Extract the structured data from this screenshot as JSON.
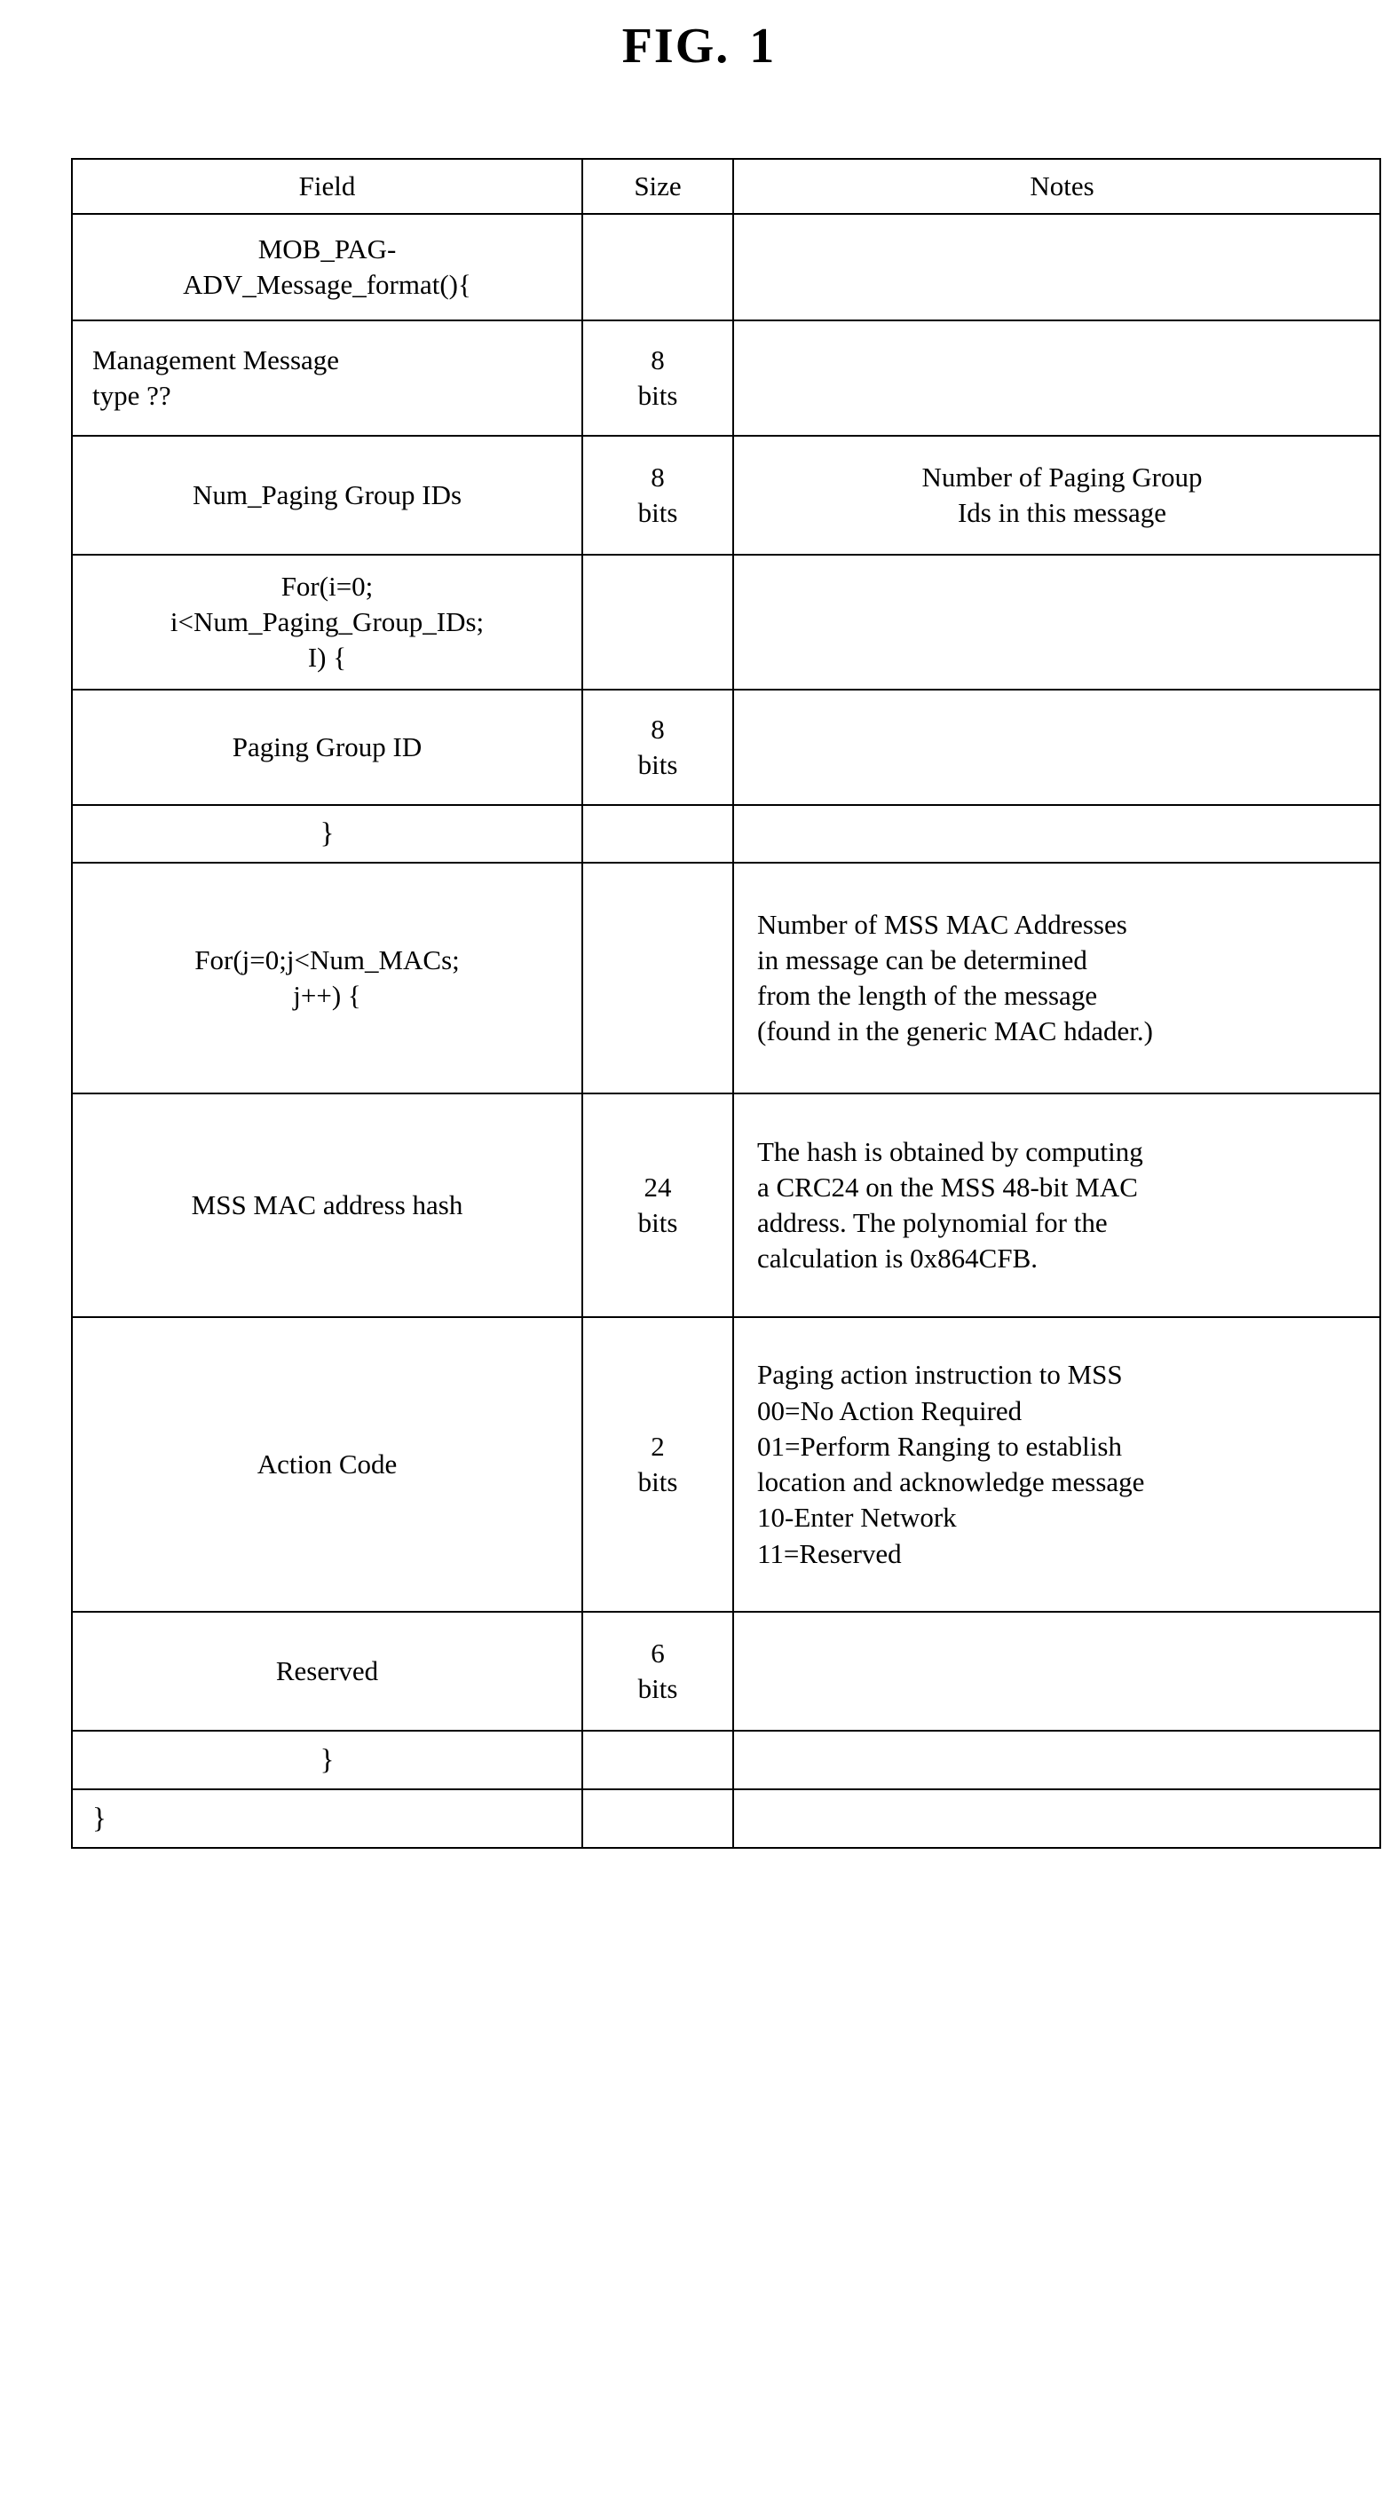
{
  "figure": {
    "title_prefix": "FIG.",
    "title_number": "1"
  },
  "table": {
    "columns": [
      {
        "key": "field",
        "header": "Field"
      },
      {
        "key": "size",
        "header": "Size"
      },
      {
        "key": "notes",
        "header": "Notes"
      }
    ],
    "rows": [
      {
        "field_lines": [
          "MOB_PAG-",
          "ADV_Message_format(){"
        ],
        "field_align": "center",
        "size_lines": [],
        "notes_lines": []
      },
      {
        "field_lines": [
          "Management Message",
          "type ??"
        ],
        "field_align": "left",
        "size_lines": [
          "8",
          "bits"
        ],
        "notes_lines": []
      },
      {
        "field_lines": [
          "Num_Paging Group IDs"
        ],
        "field_align": "center",
        "size_lines": [
          "8",
          "bits"
        ],
        "notes_lines": [
          "Number of Paging Group",
          "Ids in this message"
        ],
        "notes_align": "center"
      },
      {
        "field_lines": [
          "For(i=0;",
          "i<Num_Paging_Group_IDs;",
          "I) {"
        ],
        "field_align": "center",
        "size_lines": [],
        "notes_lines": []
      },
      {
        "field_lines": [
          "Paging Group ID"
        ],
        "field_align": "center",
        "size_lines": [
          "8",
          "bits"
        ],
        "notes_lines": []
      },
      {
        "field_lines": [
          "}"
        ],
        "field_align": "center",
        "size_lines": [],
        "notes_lines": []
      },
      {
        "field_lines": [
          "For(j=0;j<Num_MACs;",
          "j++) {"
        ],
        "field_align": "center",
        "size_lines": [],
        "notes_lines": [
          "Number of MSS MAC Addresses",
          "in message can be determined",
          "from the length of the message",
          "(found in the generic MAC hdader.)"
        ],
        "notes_align": "left"
      },
      {
        "field_lines": [
          "MSS MAC address hash"
        ],
        "field_align": "center",
        "size_lines": [
          "24",
          "bits"
        ],
        "notes_lines": [
          "The hash is obtained by computing",
          "a CRC24 on the MSS 48-bit MAC",
          "address. The polynomial for the",
          "calculation is 0x864CFB."
        ],
        "notes_align": "left"
      },
      {
        "field_lines": [
          "Action Code"
        ],
        "field_align": "center",
        "size_lines": [
          "2",
          "bits"
        ],
        "notes_lines": [
          "Paging action instruction to MSS",
          "00=No Action Required",
          "01=Perform Ranging to establish",
          "location and acknowledge message",
          "10-Enter Network",
          "11=Reserved"
        ],
        "notes_align": "left"
      },
      {
        "field_lines": [
          "Reserved"
        ],
        "field_align": "center",
        "size_lines": [
          "6",
          "bits"
        ],
        "notes_lines": []
      },
      {
        "field_lines": [
          "}"
        ],
        "field_align": "center",
        "size_lines": [],
        "notes_lines": []
      },
      {
        "field_lines": [
          "}"
        ],
        "field_align": "left",
        "size_lines": [],
        "notes_lines": []
      }
    ]
  }
}
